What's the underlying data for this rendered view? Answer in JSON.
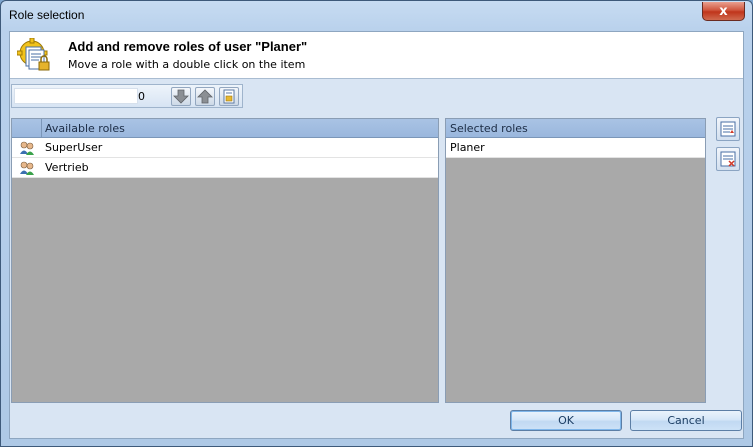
{
  "window": {
    "title": "Role selection",
    "close_glyph": "x"
  },
  "header": {
    "title": "Add and remove roles of user \"Planer\"",
    "subtitle": "Move a role with a double click on the item",
    "icon": "roles-config-icon"
  },
  "toolbar": {
    "search_value": "",
    "count": "0",
    "buttons": [
      "move-down-icon",
      "move-up-icon",
      "export-icon"
    ]
  },
  "available": {
    "header": "Available roles",
    "items": [
      {
        "label": "SuperUser",
        "icon": "role-users-icon"
      },
      {
        "label": "Vertrieb",
        "icon": "role-users-icon"
      }
    ]
  },
  "selected": {
    "header": "Selected roles",
    "items": [
      {
        "label": "Planer"
      }
    ]
  },
  "side_buttons": [
    "add-role-icon",
    "remove-role-icon"
  ],
  "footer": {
    "ok_label": "OK",
    "cancel_label": "Cancel"
  },
  "colors": {
    "accent": "#9ab7dd",
    "close": "#c0351b",
    "list_bg": "#a9a9a9"
  }
}
